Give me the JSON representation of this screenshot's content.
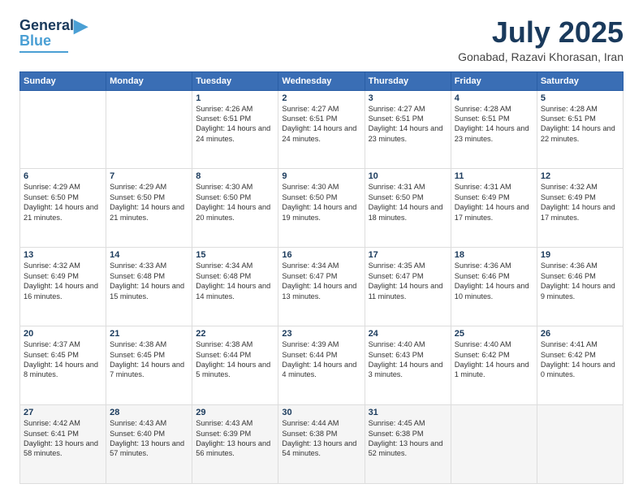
{
  "logo": {
    "line1": "General",
    "line2": "Blue"
  },
  "title": "July 2025",
  "subtitle": "Gonabad, Razavi Khorasan, Iran",
  "days_of_week": [
    "Sunday",
    "Monday",
    "Tuesday",
    "Wednesday",
    "Thursday",
    "Friday",
    "Saturday"
  ],
  "weeks": [
    [
      {
        "day": "",
        "sunrise": "",
        "sunset": "",
        "daylight": ""
      },
      {
        "day": "",
        "sunrise": "",
        "sunset": "",
        "daylight": ""
      },
      {
        "day": "1",
        "sunrise": "Sunrise: 4:26 AM",
        "sunset": "Sunset: 6:51 PM",
        "daylight": "Daylight: 14 hours and 24 minutes."
      },
      {
        "day": "2",
        "sunrise": "Sunrise: 4:27 AM",
        "sunset": "Sunset: 6:51 PM",
        "daylight": "Daylight: 14 hours and 24 minutes."
      },
      {
        "day": "3",
        "sunrise": "Sunrise: 4:27 AM",
        "sunset": "Sunset: 6:51 PM",
        "daylight": "Daylight: 14 hours and 23 minutes."
      },
      {
        "day": "4",
        "sunrise": "Sunrise: 4:28 AM",
        "sunset": "Sunset: 6:51 PM",
        "daylight": "Daylight: 14 hours and 23 minutes."
      },
      {
        "day": "5",
        "sunrise": "Sunrise: 4:28 AM",
        "sunset": "Sunset: 6:51 PM",
        "daylight": "Daylight: 14 hours and 22 minutes."
      }
    ],
    [
      {
        "day": "6",
        "sunrise": "Sunrise: 4:29 AM",
        "sunset": "Sunset: 6:50 PM",
        "daylight": "Daylight: 14 hours and 21 minutes."
      },
      {
        "day": "7",
        "sunrise": "Sunrise: 4:29 AM",
        "sunset": "Sunset: 6:50 PM",
        "daylight": "Daylight: 14 hours and 21 minutes."
      },
      {
        "day": "8",
        "sunrise": "Sunrise: 4:30 AM",
        "sunset": "Sunset: 6:50 PM",
        "daylight": "Daylight: 14 hours and 20 minutes."
      },
      {
        "day": "9",
        "sunrise": "Sunrise: 4:30 AM",
        "sunset": "Sunset: 6:50 PM",
        "daylight": "Daylight: 14 hours and 19 minutes."
      },
      {
        "day": "10",
        "sunrise": "Sunrise: 4:31 AM",
        "sunset": "Sunset: 6:50 PM",
        "daylight": "Daylight: 14 hours and 18 minutes."
      },
      {
        "day": "11",
        "sunrise": "Sunrise: 4:31 AM",
        "sunset": "Sunset: 6:49 PM",
        "daylight": "Daylight: 14 hours and 17 minutes."
      },
      {
        "day": "12",
        "sunrise": "Sunrise: 4:32 AM",
        "sunset": "Sunset: 6:49 PM",
        "daylight": "Daylight: 14 hours and 17 minutes."
      }
    ],
    [
      {
        "day": "13",
        "sunrise": "Sunrise: 4:32 AM",
        "sunset": "Sunset: 6:49 PM",
        "daylight": "Daylight: 14 hours and 16 minutes."
      },
      {
        "day": "14",
        "sunrise": "Sunrise: 4:33 AM",
        "sunset": "Sunset: 6:48 PM",
        "daylight": "Daylight: 14 hours and 15 minutes."
      },
      {
        "day": "15",
        "sunrise": "Sunrise: 4:34 AM",
        "sunset": "Sunset: 6:48 PM",
        "daylight": "Daylight: 14 hours and 14 minutes."
      },
      {
        "day": "16",
        "sunrise": "Sunrise: 4:34 AM",
        "sunset": "Sunset: 6:47 PM",
        "daylight": "Daylight: 14 hours and 13 minutes."
      },
      {
        "day": "17",
        "sunrise": "Sunrise: 4:35 AM",
        "sunset": "Sunset: 6:47 PM",
        "daylight": "Daylight: 14 hours and 11 minutes."
      },
      {
        "day": "18",
        "sunrise": "Sunrise: 4:36 AM",
        "sunset": "Sunset: 6:46 PM",
        "daylight": "Daylight: 14 hours and 10 minutes."
      },
      {
        "day": "19",
        "sunrise": "Sunrise: 4:36 AM",
        "sunset": "Sunset: 6:46 PM",
        "daylight": "Daylight: 14 hours and 9 minutes."
      }
    ],
    [
      {
        "day": "20",
        "sunrise": "Sunrise: 4:37 AM",
        "sunset": "Sunset: 6:45 PM",
        "daylight": "Daylight: 14 hours and 8 minutes."
      },
      {
        "day": "21",
        "sunrise": "Sunrise: 4:38 AM",
        "sunset": "Sunset: 6:45 PM",
        "daylight": "Daylight: 14 hours and 7 minutes."
      },
      {
        "day": "22",
        "sunrise": "Sunrise: 4:38 AM",
        "sunset": "Sunset: 6:44 PM",
        "daylight": "Daylight: 14 hours and 5 minutes."
      },
      {
        "day": "23",
        "sunrise": "Sunrise: 4:39 AM",
        "sunset": "Sunset: 6:44 PM",
        "daylight": "Daylight: 14 hours and 4 minutes."
      },
      {
        "day": "24",
        "sunrise": "Sunrise: 4:40 AM",
        "sunset": "Sunset: 6:43 PM",
        "daylight": "Daylight: 14 hours and 3 minutes."
      },
      {
        "day": "25",
        "sunrise": "Sunrise: 4:40 AM",
        "sunset": "Sunset: 6:42 PM",
        "daylight": "Daylight: 14 hours and 1 minute."
      },
      {
        "day": "26",
        "sunrise": "Sunrise: 4:41 AM",
        "sunset": "Sunset: 6:42 PM",
        "daylight": "Daylight: 14 hours and 0 minutes."
      }
    ],
    [
      {
        "day": "27",
        "sunrise": "Sunrise: 4:42 AM",
        "sunset": "Sunset: 6:41 PM",
        "daylight": "Daylight: 13 hours and 58 minutes."
      },
      {
        "day": "28",
        "sunrise": "Sunrise: 4:43 AM",
        "sunset": "Sunset: 6:40 PM",
        "daylight": "Daylight: 13 hours and 57 minutes."
      },
      {
        "day": "29",
        "sunrise": "Sunrise: 4:43 AM",
        "sunset": "Sunset: 6:39 PM",
        "daylight": "Daylight: 13 hours and 56 minutes."
      },
      {
        "day": "30",
        "sunrise": "Sunrise: 4:44 AM",
        "sunset": "Sunset: 6:38 PM",
        "daylight": "Daylight: 13 hours and 54 minutes."
      },
      {
        "day": "31",
        "sunrise": "Sunrise: 4:45 AM",
        "sunset": "Sunset: 6:38 PM",
        "daylight": "Daylight: 13 hours and 52 minutes."
      },
      {
        "day": "",
        "sunrise": "",
        "sunset": "",
        "daylight": ""
      },
      {
        "day": "",
        "sunrise": "",
        "sunset": "",
        "daylight": ""
      }
    ]
  ]
}
